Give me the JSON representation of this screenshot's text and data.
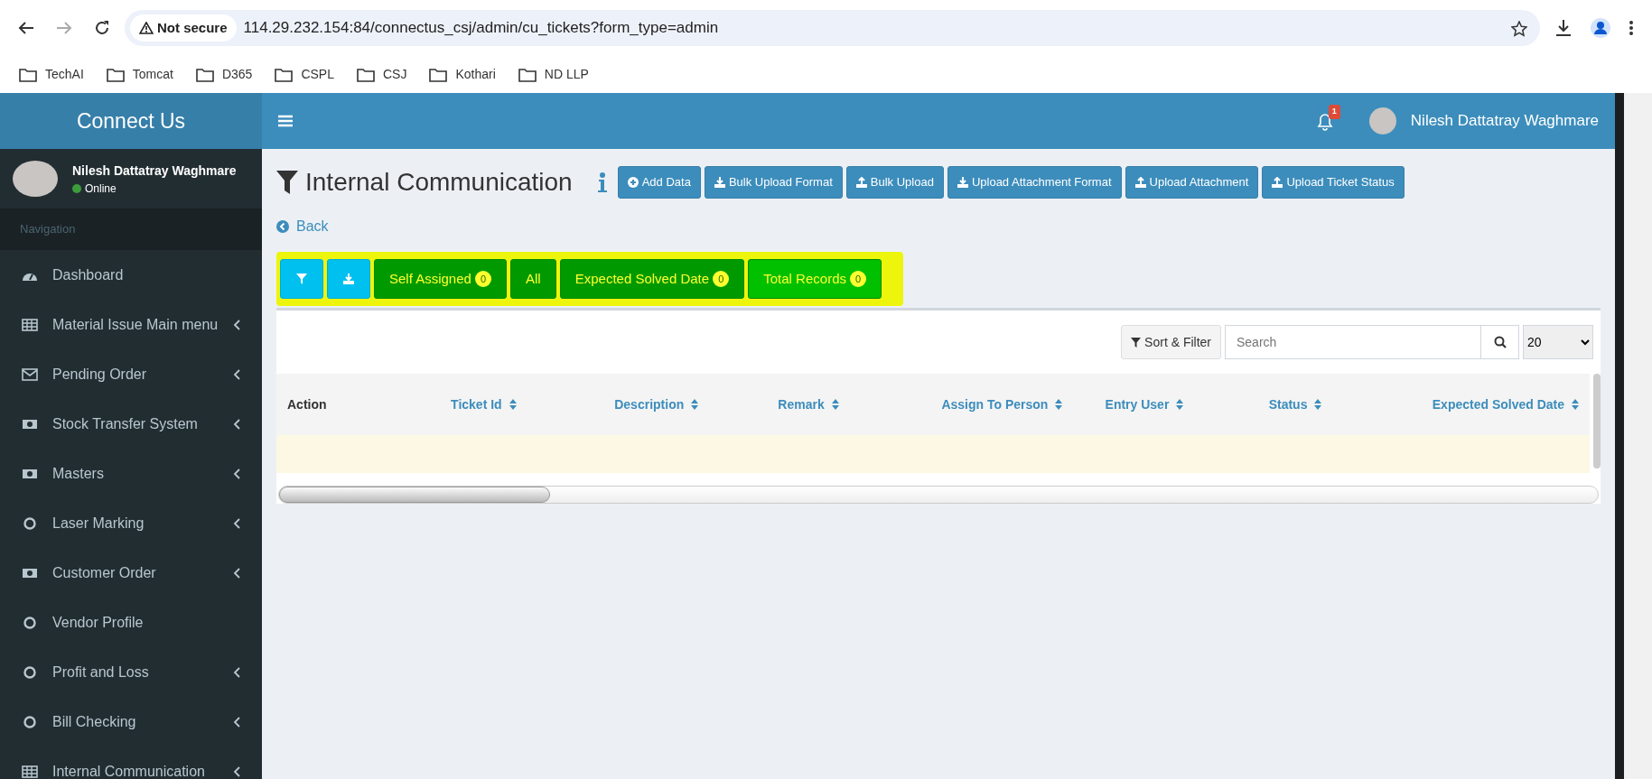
{
  "browser": {
    "security": "Not secure",
    "url": "114.29.232.154:84/connectus_csj/admin/cu_tickets?form_type=admin",
    "bookmarks": [
      "TechAI",
      "Tomcat",
      "D365",
      "CSPL",
      "CSJ",
      "Kothari",
      "ND LLP"
    ]
  },
  "sidebar": {
    "brand": "Connect Us",
    "user": {
      "name": "Nilesh Dattatray Waghmare",
      "status": "Online"
    },
    "section_label": "Navigation",
    "items": [
      {
        "label": "Dashboard",
        "kind": "dashboard",
        "expandable": false
      },
      {
        "label": "Material Issue Main menu",
        "kind": "grid",
        "expandable": true
      },
      {
        "label": "Pending Order",
        "kind": "mail",
        "expandable": true
      },
      {
        "label": "Stock Transfer System",
        "kind": "cash",
        "expandable": true
      },
      {
        "label": "Masters",
        "kind": "cash",
        "expandable": true
      },
      {
        "label": "Laser Marking",
        "kind": "circle",
        "expandable": true
      },
      {
        "label": "Customer Order",
        "kind": "cash",
        "expandable": true
      },
      {
        "label": "Vendor Profile",
        "kind": "circle",
        "expandable": false
      },
      {
        "label": "Profit and Loss",
        "kind": "circle",
        "expandable": true
      },
      {
        "label": "Bill Checking",
        "kind": "circle",
        "expandable": true
      },
      {
        "label": "Internal Communication",
        "kind": "grid",
        "expandable": true
      }
    ]
  },
  "header": {
    "notification_count": "1",
    "user_name": "Nilesh Dattatray Waghmare"
  },
  "page": {
    "title": "Internal Communication",
    "actions": [
      {
        "label": "Add Data",
        "kind": "add"
      },
      {
        "label": "Bulk Upload Format",
        "kind": "download"
      },
      {
        "label": "Bulk Upload",
        "kind": "upload"
      },
      {
        "label": "Upload Attachment Format",
        "kind": "download"
      },
      {
        "label": "Upload Attachment",
        "kind": "upload"
      },
      {
        "label": "Upload Ticket Status",
        "kind": "upload"
      }
    ],
    "back": "Back",
    "filters": [
      {
        "label": "Self Assigned",
        "count": "0",
        "selected": false
      },
      {
        "label": "All",
        "selected": false
      },
      {
        "label": "Expected Solved Date",
        "count": "0",
        "selected": false
      },
      {
        "label": "Total Records",
        "count": "0",
        "selected": true
      }
    ],
    "toolbar": {
      "sort_button": "Sort & Filter",
      "search_placeholder": "Search",
      "page_size": "20"
    },
    "table": {
      "columns": [
        {
          "label": "Action",
          "sortable": false
        },
        {
          "label": "Ticket Id",
          "sortable": true
        },
        {
          "label": "Description",
          "sortable": true
        },
        {
          "label": "Remark",
          "sortable": true
        },
        {
          "label": "Assign To Person",
          "sortable": true
        },
        {
          "label": "Entry User",
          "sortable": true
        },
        {
          "label": "Status",
          "sortable": true
        },
        {
          "label": "Expected Solved Date",
          "sortable": true
        }
      ]
    }
  }
}
